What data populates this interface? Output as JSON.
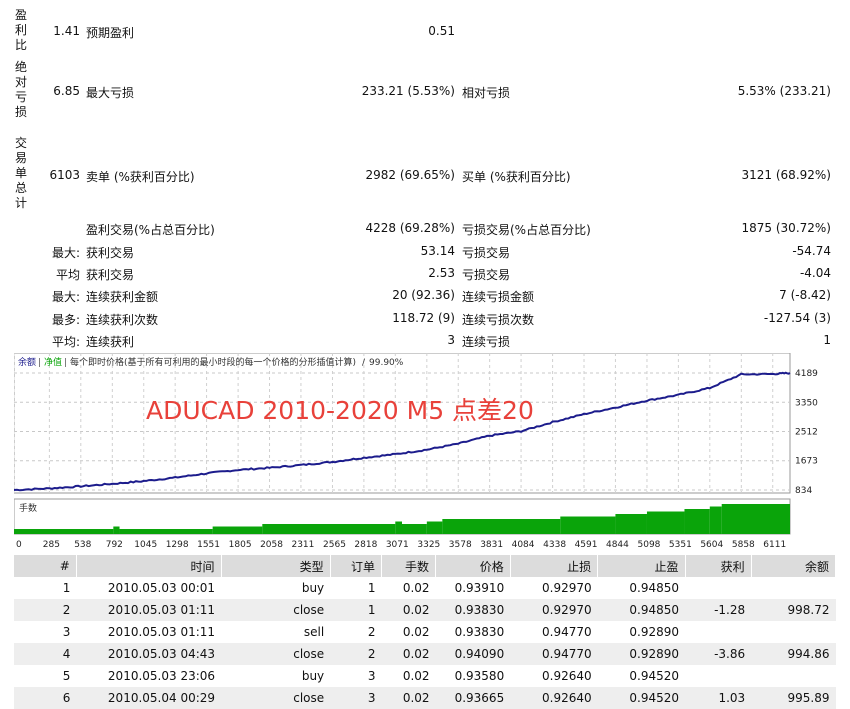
{
  "stats": {
    "profit_factor_label": "盈利比",
    "profit_factor": "1.41",
    "expected_payoff_label": "预期盈利",
    "expected_payoff": "0.51",
    "absolute_dd_label": "绝对亏损",
    "absolute_dd": "6.85",
    "max_dd_label": "最大亏损",
    "max_dd": "233.21 (5.53%)",
    "relative_dd_label": "相对亏损",
    "relative_dd": "5.53% (233.21)",
    "total_trades_label": "交易单总计",
    "total_trades": "6103",
    "short_label": "卖单 (%获利百分比)",
    "short_value": "2982 (69.65%)",
    "long_label": "买单 (%获利百分比)",
    "long_value": "3121 (68.92%)",
    "profit_trades_label": "盈利交易(%占总百分比)",
    "profit_trades_value": "4228 (69.28%)",
    "loss_trades_label": "亏损交易(%占总百分比)",
    "loss_trades_value": "1875 (30.72%)",
    "rows": [
      {
        "prefix": "最大:",
        "l_label": "获利交易",
        "l_value": "53.14",
        "r_label": "亏损交易",
        "r_value": "-54.74"
      },
      {
        "prefix": "平均",
        "l_label": "获利交易",
        "l_value": "2.53",
        "r_label": "亏损交易",
        "r_value": "-4.04"
      },
      {
        "prefix": "最大:",
        "l_label": "连续获利金额",
        "l_value": "20 (92.36)",
        "r_label": "连续亏损金额",
        "r_value": "7 (-8.42)"
      },
      {
        "prefix": "最多:",
        "l_label": "连续获利次数",
        "l_value": "118.72 (9)",
        "r_label": "连续亏损次数",
        "r_value": "-127.54 (3)"
      },
      {
        "prefix": "平均:",
        "l_label": "连续获利",
        "l_value": "3",
        "r_label": "连续亏损",
        "r_value": "1"
      }
    ]
  },
  "chart_legend": {
    "balance": "余额",
    "equity": "净值",
    "model": "每个即时价格(基于所有可利用的最小时段的每一个价格的分形插值计算)",
    "quality": "99.90%",
    "volume_label": "手数"
  },
  "overlay_title": "ADUCAD 2010-2020 M5 点差20",
  "colors": {
    "balance": "#1c1c8c",
    "volume": "#0aa40a",
    "overlay": "#e8413a",
    "legend_balance": "#1c1c8c",
    "legend_equity": "#0aa40a"
  },
  "chart_data": {
    "type": "line",
    "series": [
      {
        "name": "余额",
        "x": [
          0,
          285,
          538,
          792,
          1045,
          1298,
          1551,
          1805,
          2058,
          2311,
          2565,
          2818,
          3071,
          3325,
          3578,
          3831,
          4084,
          4338,
          4591,
          4844,
          5098,
          5351,
          5604,
          5858,
          6111,
          6250
        ],
        "y": [
          834,
          880,
          940,
          1010,
          1090,
          1190,
          1310,
          1410,
          1470,
          1550,
          1640,
          1760,
          1860,
          1990,
          2160,
          2390,
          2520,
          2780,
          3010,
          3200,
          3400,
          3560,
          3760,
          4150,
          4160,
          4189
        ]
      }
    ],
    "y_ticks": [
      "834",
      "1673",
      "2512",
      "3350",
      "4189"
    ],
    "ylim": [
      834,
      4189
    ],
    "x_ticks": [
      "0",
      "285",
      "538",
      "792",
      "1045",
      "1298",
      "1551",
      "1805",
      "2058",
      "2311",
      "2565",
      "2818",
      "3071",
      "3325",
      "3578",
      "3831",
      "4084",
      "4338",
      "4591",
      "4844",
      "5098",
      "5351",
      "5604",
      "5858",
      "6111"
    ],
    "xlim": [
      0,
      6250
    ],
    "volume": {
      "name": "手数",
      "x": [
        0,
        800,
        850,
        1600,
        2000,
        3071,
        3125,
        3325,
        3450,
        4400,
        4844,
        5098,
        5400,
        5604,
        5700,
        6250
      ],
      "lots": [
        0.02,
        0.03,
        0.02,
        0.03,
        0.04,
        0.05,
        0.04,
        0.05,
        0.06,
        0.07,
        0.08,
        0.09,
        0.1,
        0.11,
        0.12,
        0.12
      ]
    },
    "grid": true
  },
  "deals": {
    "headers": [
      "#",
      "时间",
      "类型",
      "订单",
      "手数",
      "价格",
      "止损",
      "止盈",
      "获利",
      "余额"
    ],
    "rows": [
      [
        "1",
        "2010.05.03 00:01",
        "buy",
        "1",
        "0.02",
        "0.93910",
        "0.92970",
        "0.94850",
        "",
        ""
      ],
      [
        "2",
        "2010.05.03 01:11",
        "close",
        "1",
        "0.02",
        "0.93830",
        "0.92970",
        "0.94850",
        "-1.28",
        "998.72"
      ],
      [
        "3",
        "2010.05.03 01:11",
        "sell",
        "2",
        "0.02",
        "0.93830",
        "0.94770",
        "0.92890",
        "",
        ""
      ],
      [
        "4",
        "2010.05.03 04:43",
        "close",
        "2",
        "0.02",
        "0.94090",
        "0.94770",
        "0.92890",
        "-3.86",
        "994.86"
      ],
      [
        "5",
        "2010.05.03 23:06",
        "buy",
        "3",
        "0.02",
        "0.93580",
        "0.92640",
        "0.94520",
        "",
        ""
      ],
      [
        "6",
        "2010.05.04 00:29",
        "close",
        "3",
        "0.02",
        "0.93665",
        "0.92640",
        "0.94520",
        "1.03",
        "995.89"
      ]
    ]
  }
}
